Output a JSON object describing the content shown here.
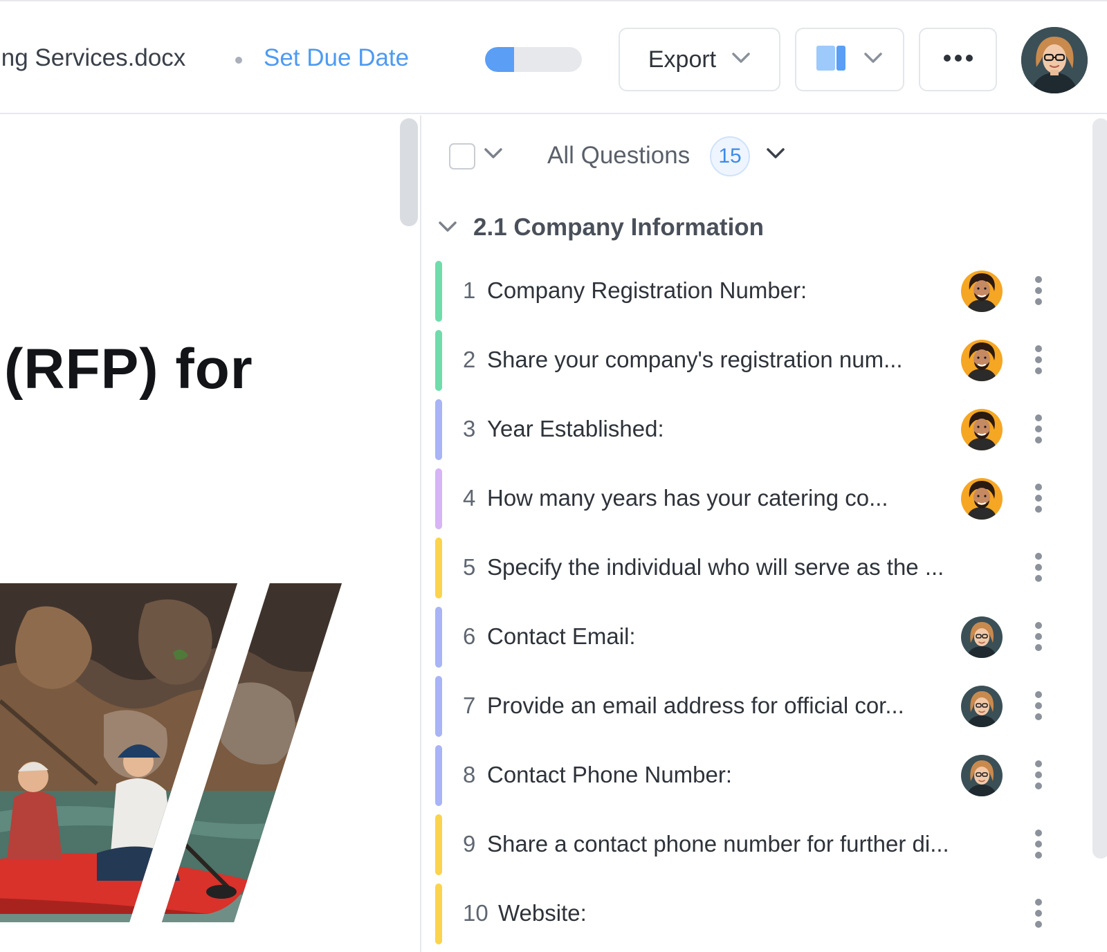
{
  "header": {
    "doc_title": "ing Services.docx",
    "due_date_link": "Set Due Date",
    "progress_fraction": 0.3,
    "export_label": "Export",
    "icons": {
      "export_chevron": "chevron-down-icon",
      "layout": "split-view-icon",
      "more": "more-horizontal-icon"
    },
    "colors": {
      "link": "#4e9af1",
      "progress": "#5a9ef5"
    }
  },
  "document": {
    "heading": "(RFP) for"
  },
  "questions_panel": {
    "filter_label": "All Questions",
    "count": "15",
    "section": {
      "title": "2.1 Company Information"
    },
    "items": [
      {
        "num": "1",
        "text": "Company Registration Number:",
        "color": "#6fdcab",
        "assignee": "man"
      },
      {
        "num": "2",
        "text": "Share your company's registration num...",
        "color": "#6fdcab",
        "assignee": "man"
      },
      {
        "num": "3",
        "text": "Year Established:",
        "color": "#a8b4f5",
        "assignee": "man"
      },
      {
        "num": "4",
        "text": "How many years has your catering co...",
        "color": "#d6b4f5",
        "assignee": "man"
      },
      {
        "num": "5",
        "text": "Specify the individual who will serve as the ...",
        "color": "#fbd34d",
        "assignee": ""
      },
      {
        "num": "6",
        "text": "Contact Email:",
        "color": "#a8b4f5",
        "assignee": "woman"
      },
      {
        "num": "7",
        "text": "Provide an email address for official cor...",
        "color": "#a8b4f5",
        "assignee": "woman"
      },
      {
        "num": "8",
        "text": "Contact Phone Number:",
        "color": "#a8b4f5",
        "assignee": "woman"
      },
      {
        "num": "9",
        "text": "Share a contact phone number for further di...",
        "color": "#fbd34d",
        "assignee": ""
      },
      {
        "num": "10",
        "text": "Website:",
        "color": "#fbd34d",
        "assignee": ""
      }
    ]
  }
}
